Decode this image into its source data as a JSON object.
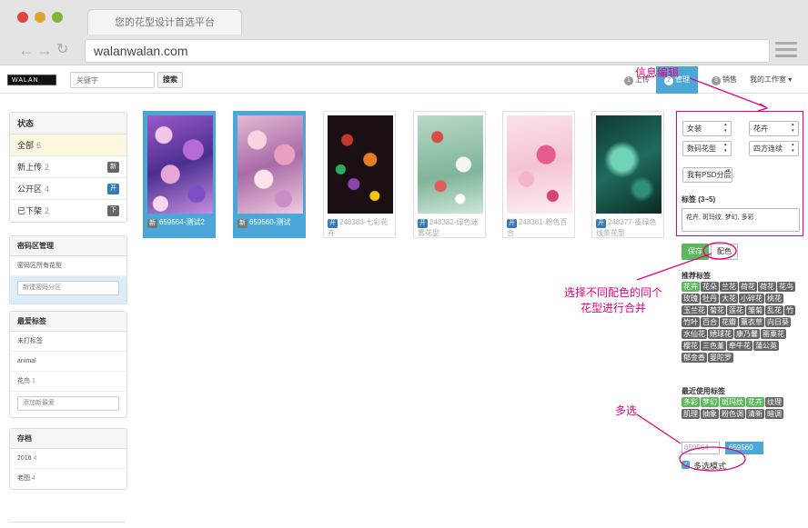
{
  "browser": {
    "tab_title": "您的花型设计首选平台",
    "url": "walanwalan.com"
  },
  "header": {
    "logo_text": "WALAN",
    "search_placeholder": "关键字",
    "search_button": "搜索",
    "nav": [
      {
        "num": "1",
        "label": "上传"
      },
      {
        "num": "2",
        "label": "管理"
      },
      {
        "num": "3",
        "label": "销售"
      },
      {
        "label": "我的工作室 ▾"
      }
    ]
  },
  "sidebar": {
    "status": {
      "title": "状态",
      "items": [
        {
          "label": "全部",
          "count": "6",
          "badge": ""
        },
        {
          "label": "新上传",
          "count": "2",
          "badge": "新"
        },
        {
          "label": "公开区",
          "count": "4",
          "badge": "开"
        },
        {
          "label": "已下架",
          "count": "2",
          "badge": "下"
        }
      ]
    },
    "password": {
      "title": "密码区管理",
      "all": "密码区所有花型",
      "new_placeholder": "新建密码分区"
    },
    "fav": {
      "title": "最爱标签",
      "items": [
        {
          "label": "未打标签",
          "count": ""
        },
        {
          "label": "animal",
          "count": ""
        },
        {
          "label": "花鸟",
          "count": "1"
        }
      ],
      "add_placeholder": "添加新最爱"
    },
    "archive": {
      "title": "存档",
      "items": [
        {
          "label": "2016",
          "count": "4"
        },
        {
          "label": "老图",
          "count": "4"
        }
      ]
    }
  },
  "cards": [
    {
      "badge": "新",
      "title": "659564-测试2"
    },
    {
      "badge": "新",
      "title": "659560-测试"
    },
    {
      "badge": "开",
      "title": "248383-七彩花卉"
    },
    {
      "badge": "开",
      "title": "248382-绿色迷雾花型"
    },
    {
      "badge": "开",
      "title": "248381-粉色百合"
    },
    {
      "badge": "开",
      "title": "248377-墨绿色线条花型"
    }
  ],
  "editor": {
    "sel_category": "女装",
    "sel_type": "花卉",
    "sel_print": "数码花型",
    "sel_repeat": "四方连续",
    "sel_psd": "我有PSD分层",
    "tags_label": "标签 (3~5)",
    "tags_value": "花卉, 斑玛纹, 梦幻, 多彩",
    "save_button": "保存",
    "color_button": "配色",
    "recommended_title": "推荐标签",
    "recommended": [
      "花卉",
      "花朵",
      "兰花",
      "荷花",
      "荷花",
      "花鸟",
      "玫瑰",
      "牡丹",
      "大花",
      "小碎花",
      "桃花",
      "玉兰花",
      "菊花",
      "莲花",
      "雏菊",
      "乱花",
      "竹",
      "竹叶",
      "百合",
      "花瓣",
      "薰衣草",
      "向日葵",
      "水仙花",
      "绣球花",
      "康乃馨",
      "罂粟花",
      "樱花",
      "三色堇",
      "牵牛花",
      "蒲公英",
      "郁金香",
      "曼陀罗"
    ],
    "recommended_green": [
      "花卉"
    ],
    "recent_title": "最近使用标签",
    "recent": [
      "多彩",
      "梦幻",
      "斑玛纹",
      "花卉",
      "纹理",
      "肌理",
      "抽象",
      "粉色调",
      "清新",
      "暗调"
    ],
    "recent_green": [
      "多彩",
      "梦幻",
      "斑玛纹",
      "花卉"
    ],
    "selected_ids": [
      "659564",
      "659560"
    ],
    "multi_mode_label": "多选模式"
  },
  "annotations": {
    "edit_info": "信息编辑",
    "color_merge": "选择不同配色的同个\n花型进行合并",
    "multi_select": "多选"
  },
  "colors": {
    "accent_blue": "#4aa7d8",
    "annotation_pink": "#e6007e",
    "tag_green": "#5cb85c",
    "badge_gray": "#666666"
  }
}
